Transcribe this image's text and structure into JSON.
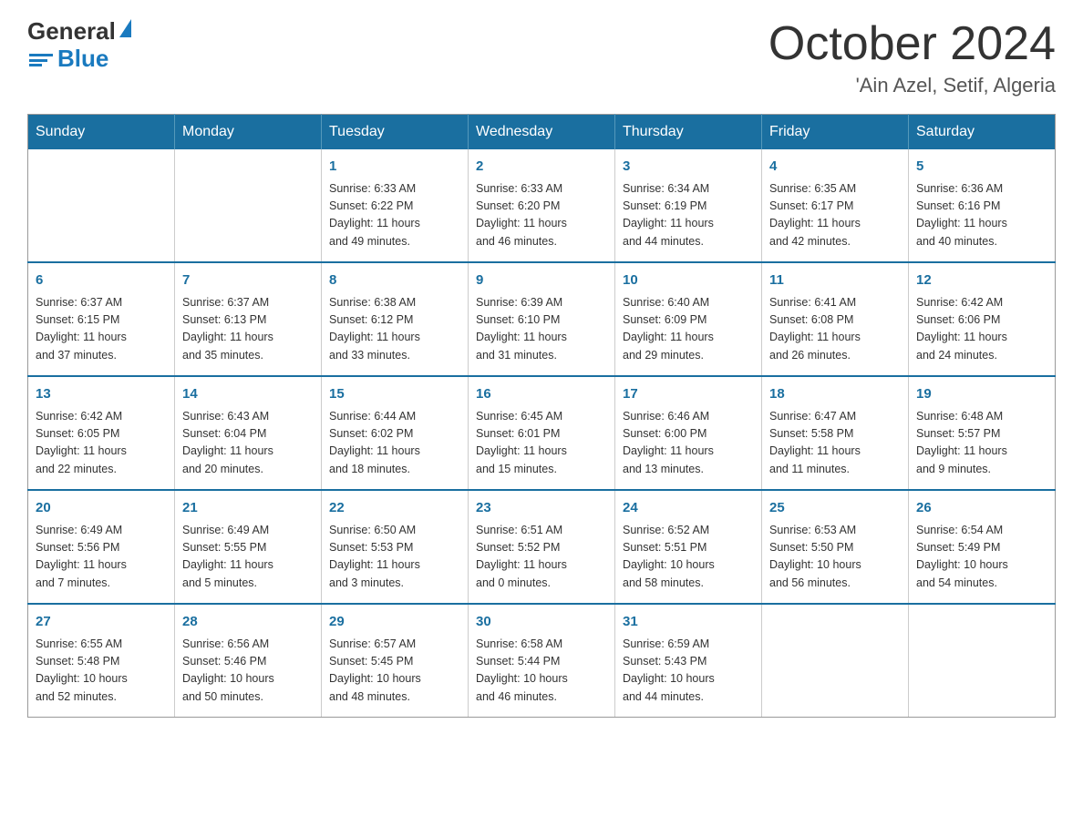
{
  "header": {
    "title": "October 2024",
    "subtitle": "'Ain Azel, Setif, Algeria",
    "logo_general": "General",
    "logo_blue": "Blue"
  },
  "weekdays": [
    "Sunday",
    "Monday",
    "Tuesday",
    "Wednesday",
    "Thursday",
    "Friday",
    "Saturday"
  ],
  "weeks": [
    [
      {
        "day": "",
        "info": ""
      },
      {
        "day": "",
        "info": ""
      },
      {
        "day": "1",
        "info": "Sunrise: 6:33 AM\nSunset: 6:22 PM\nDaylight: 11 hours\nand 49 minutes."
      },
      {
        "day": "2",
        "info": "Sunrise: 6:33 AM\nSunset: 6:20 PM\nDaylight: 11 hours\nand 46 minutes."
      },
      {
        "day": "3",
        "info": "Sunrise: 6:34 AM\nSunset: 6:19 PM\nDaylight: 11 hours\nand 44 minutes."
      },
      {
        "day": "4",
        "info": "Sunrise: 6:35 AM\nSunset: 6:17 PM\nDaylight: 11 hours\nand 42 minutes."
      },
      {
        "day": "5",
        "info": "Sunrise: 6:36 AM\nSunset: 6:16 PM\nDaylight: 11 hours\nand 40 minutes."
      }
    ],
    [
      {
        "day": "6",
        "info": "Sunrise: 6:37 AM\nSunset: 6:15 PM\nDaylight: 11 hours\nand 37 minutes."
      },
      {
        "day": "7",
        "info": "Sunrise: 6:37 AM\nSunset: 6:13 PM\nDaylight: 11 hours\nand 35 minutes."
      },
      {
        "day": "8",
        "info": "Sunrise: 6:38 AM\nSunset: 6:12 PM\nDaylight: 11 hours\nand 33 minutes."
      },
      {
        "day": "9",
        "info": "Sunrise: 6:39 AM\nSunset: 6:10 PM\nDaylight: 11 hours\nand 31 minutes."
      },
      {
        "day": "10",
        "info": "Sunrise: 6:40 AM\nSunset: 6:09 PM\nDaylight: 11 hours\nand 29 minutes."
      },
      {
        "day": "11",
        "info": "Sunrise: 6:41 AM\nSunset: 6:08 PM\nDaylight: 11 hours\nand 26 minutes."
      },
      {
        "day": "12",
        "info": "Sunrise: 6:42 AM\nSunset: 6:06 PM\nDaylight: 11 hours\nand 24 minutes."
      }
    ],
    [
      {
        "day": "13",
        "info": "Sunrise: 6:42 AM\nSunset: 6:05 PM\nDaylight: 11 hours\nand 22 minutes."
      },
      {
        "day": "14",
        "info": "Sunrise: 6:43 AM\nSunset: 6:04 PM\nDaylight: 11 hours\nand 20 minutes."
      },
      {
        "day": "15",
        "info": "Sunrise: 6:44 AM\nSunset: 6:02 PM\nDaylight: 11 hours\nand 18 minutes."
      },
      {
        "day": "16",
        "info": "Sunrise: 6:45 AM\nSunset: 6:01 PM\nDaylight: 11 hours\nand 15 minutes."
      },
      {
        "day": "17",
        "info": "Sunrise: 6:46 AM\nSunset: 6:00 PM\nDaylight: 11 hours\nand 13 minutes."
      },
      {
        "day": "18",
        "info": "Sunrise: 6:47 AM\nSunset: 5:58 PM\nDaylight: 11 hours\nand 11 minutes."
      },
      {
        "day": "19",
        "info": "Sunrise: 6:48 AM\nSunset: 5:57 PM\nDaylight: 11 hours\nand 9 minutes."
      }
    ],
    [
      {
        "day": "20",
        "info": "Sunrise: 6:49 AM\nSunset: 5:56 PM\nDaylight: 11 hours\nand 7 minutes."
      },
      {
        "day": "21",
        "info": "Sunrise: 6:49 AM\nSunset: 5:55 PM\nDaylight: 11 hours\nand 5 minutes."
      },
      {
        "day": "22",
        "info": "Sunrise: 6:50 AM\nSunset: 5:53 PM\nDaylight: 11 hours\nand 3 minutes."
      },
      {
        "day": "23",
        "info": "Sunrise: 6:51 AM\nSunset: 5:52 PM\nDaylight: 11 hours\nand 0 minutes."
      },
      {
        "day": "24",
        "info": "Sunrise: 6:52 AM\nSunset: 5:51 PM\nDaylight: 10 hours\nand 58 minutes."
      },
      {
        "day": "25",
        "info": "Sunrise: 6:53 AM\nSunset: 5:50 PM\nDaylight: 10 hours\nand 56 minutes."
      },
      {
        "day": "26",
        "info": "Sunrise: 6:54 AM\nSunset: 5:49 PM\nDaylight: 10 hours\nand 54 minutes."
      }
    ],
    [
      {
        "day": "27",
        "info": "Sunrise: 6:55 AM\nSunset: 5:48 PM\nDaylight: 10 hours\nand 52 minutes."
      },
      {
        "day": "28",
        "info": "Sunrise: 6:56 AM\nSunset: 5:46 PM\nDaylight: 10 hours\nand 50 minutes."
      },
      {
        "day": "29",
        "info": "Sunrise: 6:57 AM\nSunset: 5:45 PM\nDaylight: 10 hours\nand 48 minutes."
      },
      {
        "day": "30",
        "info": "Sunrise: 6:58 AM\nSunset: 5:44 PM\nDaylight: 10 hours\nand 46 minutes."
      },
      {
        "day": "31",
        "info": "Sunrise: 6:59 AM\nSunset: 5:43 PM\nDaylight: 10 hours\nand 44 minutes."
      },
      {
        "day": "",
        "info": ""
      },
      {
        "day": "",
        "info": ""
      }
    ]
  ]
}
